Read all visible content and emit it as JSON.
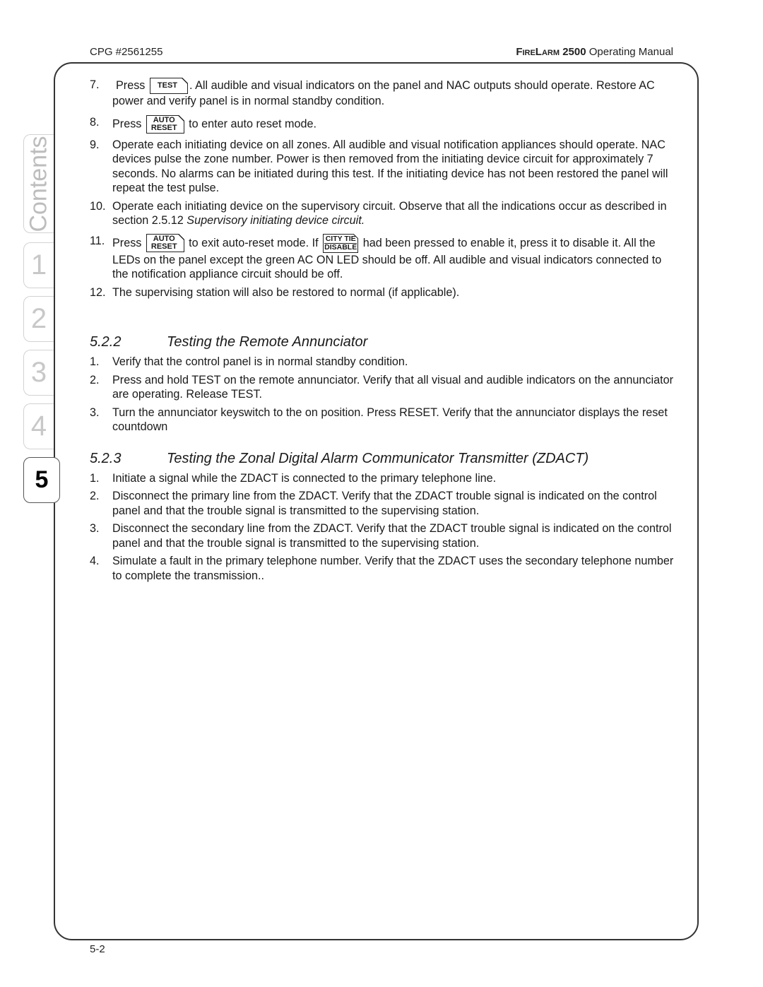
{
  "header": {
    "doc_id": "CPG #2561255",
    "brand": "FireLarm",
    "model": "2500",
    "title_suffix": "Operating Manual"
  },
  "tabs": [
    {
      "label": "Contents",
      "active": false
    },
    {
      "label": "1",
      "active": false
    },
    {
      "label": "2",
      "active": false
    },
    {
      "label": "3",
      "active": false
    },
    {
      "label": "4",
      "active": false
    },
    {
      "label": "5",
      "active": true
    }
  ],
  "keys": {
    "test": "TEST",
    "auto_reset_top": "AUTO",
    "auto_reset_bottom": "RESET",
    "city_tie_top": "CITY TIE",
    "city_tie_bottom": "DISABLE"
  },
  "steps_top": [
    {
      "num": "7.",
      "pre": "Press",
      "post": ". All audible and visual indicators on the panel and NAC outputs should operate. Restore AC power and verify panel is in normal standby condition."
    },
    {
      "num": "8.",
      "pre": "Press",
      "post": "to enter auto reset mode."
    },
    {
      "num": "9.",
      "text": "Operate each initiating device on all zones. All audible and visual notification appliances should operate. NAC devices pulse the zone number. Power is then removed from the initiating device circuit for approximately 7 seconds. No alarms can be initiated during this test. If the initiating device has not been restored the panel will repeat the test pulse."
    },
    {
      "num": "10.",
      "text": "Operate each initiating device on the supervisory circuit. Observe that all the indications occur as described in section 2.5.12 ",
      "italic": "Supervisory initiating device circuit."
    },
    {
      "num": "11.",
      "pre": "Press",
      "mid": "to exit auto-reset mode. If",
      "post": "had been pressed to enable it, press it to disable it. All the LEDs on the panel except the green AC ON LED should be off. All audible and visual indicators connected to the notification appliance circuit should be off."
    },
    {
      "num": "12.",
      "text": "The supervising station will also be restored to normal (if applicable)."
    }
  ],
  "sections": [
    {
      "number": "5.2.2",
      "title": "Testing the Remote Annunciator",
      "steps": [
        {
          "num": "1.",
          "text": "Verify that the control panel is in normal standby condition."
        },
        {
          "num": "2.",
          "text": "Press and hold TEST on the remote annunciator. Verify that all visual and audible indicators on the annunciator are operating. Release TEST."
        },
        {
          "num": "3.",
          "text": "Turn the annunciator keyswitch to the on position. Press RESET. Verify that the annunciator displays the reset countdown"
        }
      ]
    },
    {
      "number": "5.2.3",
      "title": "Testing the Zonal Digital Alarm Communicator Transmitter (ZDACT)",
      "steps": [
        {
          "num": "1.",
          "text": "Initiate a signal while the ZDACT is connected to the primary telephone line."
        },
        {
          "num": "2.",
          "text": "Disconnect the primary line from the ZDACT. Verify that the ZDACT trouble signal is indicated on the control panel and that the trouble signal is transmitted to the supervising station."
        },
        {
          "num": "3.",
          "text": "Disconnect the secondary line from the ZDACT. Verify that the ZDACT trouble signal is indicated on the control panel and that the trouble signal is transmitted to the supervising station."
        },
        {
          "num": "4.",
          "text": "Simulate a fault in the primary telephone number. Verify that the ZDACT uses the secondary telephone number to complete the transmission.."
        }
      ]
    }
  ],
  "footer": {
    "page_number": "5-2"
  }
}
